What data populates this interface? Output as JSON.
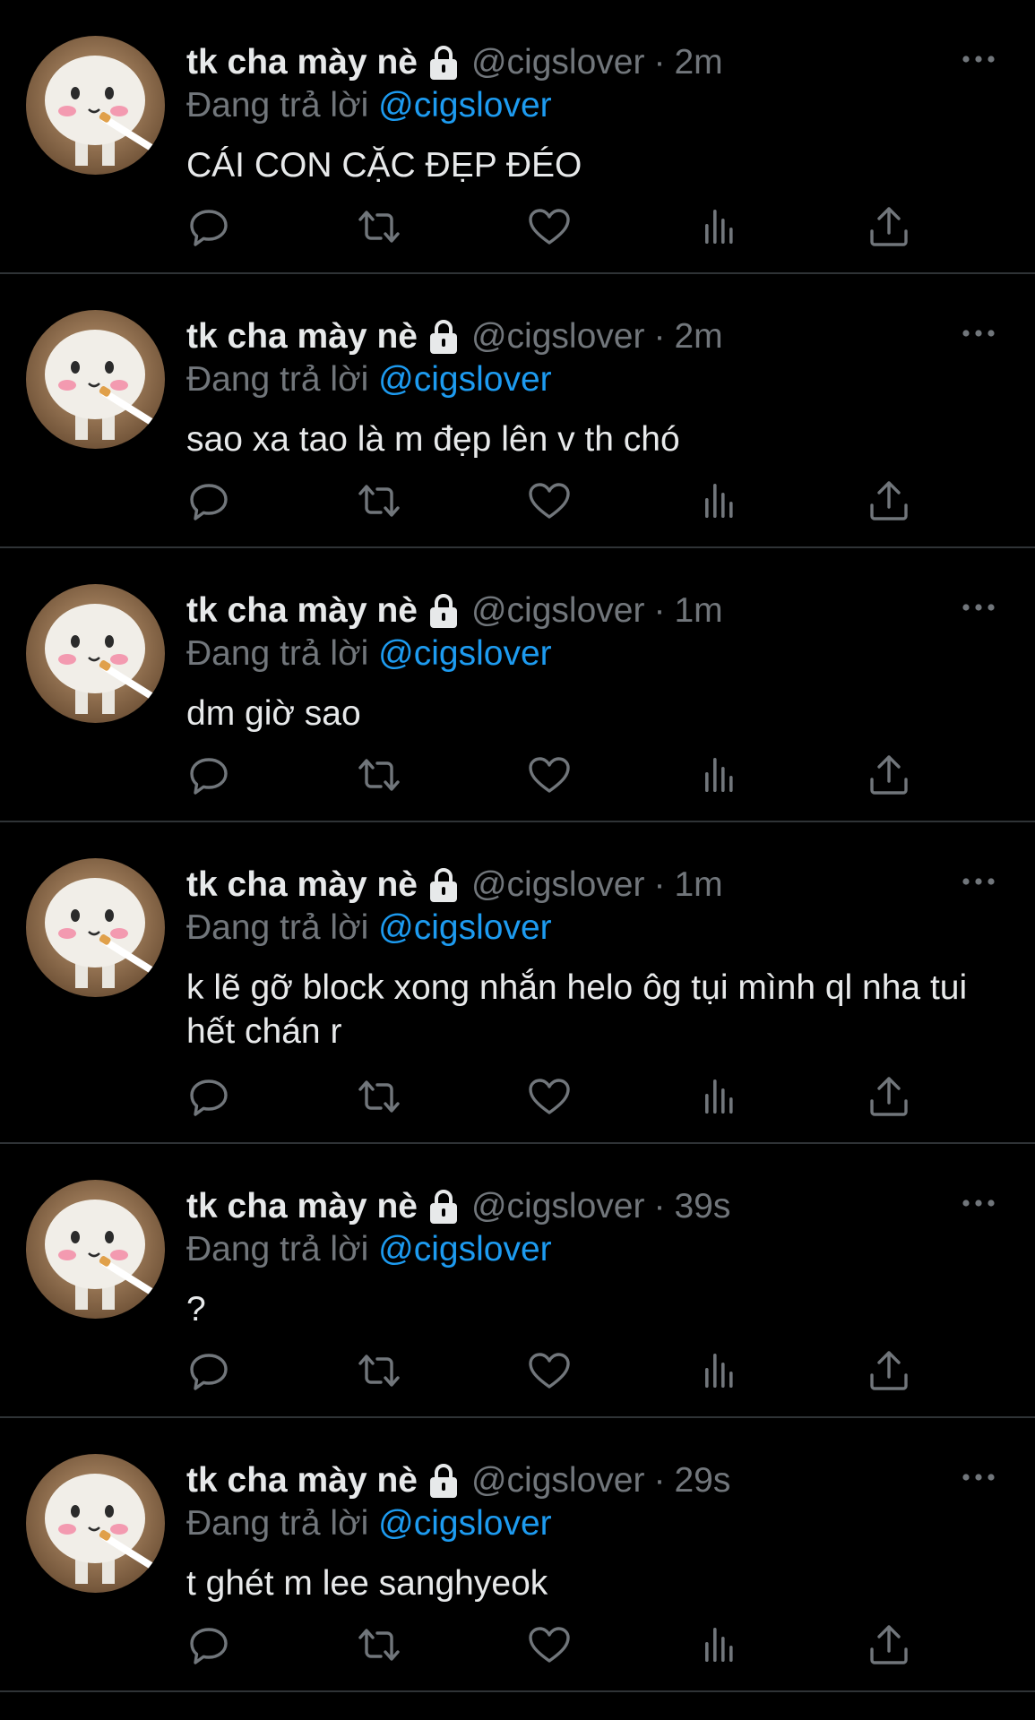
{
  "feed": {
    "tweets": [
      {
        "display_name": "tk cha mày nè",
        "handle": "@cigslover",
        "separator": "·",
        "time": "2m",
        "reply_prefix": "Đang trả lời",
        "reply_to": "@cigslover",
        "text": "CÁI CON CẶC ĐẸP ĐÉO"
      },
      {
        "display_name": "tk cha mày nè",
        "handle": "@cigslover",
        "separator": "·",
        "time": "2m",
        "reply_prefix": "Đang trả lời",
        "reply_to": "@cigslover",
        "text": "sao xa tao là m đẹp lên v th chó"
      },
      {
        "display_name": "tk cha mày nè",
        "handle": "@cigslover",
        "separator": "·",
        "time": "1m",
        "reply_prefix": "Đang trả lời",
        "reply_to": "@cigslover",
        "text": "dm giờ sao"
      },
      {
        "display_name": "tk cha mày nè",
        "handle": "@cigslover",
        "separator": "·",
        "time": "1m",
        "reply_prefix": "Đang trả lời",
        "reply_to": "@cigslover",
        "text": "k lẽ gỡ block xong nhắn helo ôg tụi mình ql nha tui hết chán r"
      },
      {
        "display_name": "tk cha mày nè",
        "handle": "@cigslover",
        "separator": "·",
        "time": "39s",
        "reply_prefix": "Đang trả lời",
        "reply_to": "@cigslover",
        "text": "?"
      },
      {
        "display_name": "tk cha mày nè",
        "handle": "@cigslover",
        "separator": "·",
        "time": "29s",
        "reply_prefix": "Đang trả lời",
        "reply_to": "@cigslover",
        "text": "t ghét m lee sanghyeok"
      }
    ]
  },
  "icons": {
    "lock": "lock-icon",
    "more": "more-icon",
    "reply": "reply-icon",
    "retweet": "retweet-icon",
    "like": "like-icon",
    "views": "views-icon",
    "share": "share-icon"
  },
  "colors": {
    "background": "#000000",
    "text": "#e7e9ea",
    "muted": "#71767b",
    "mention": "#1d9bf0",
    "divider": "#2f3336"
  }
}
